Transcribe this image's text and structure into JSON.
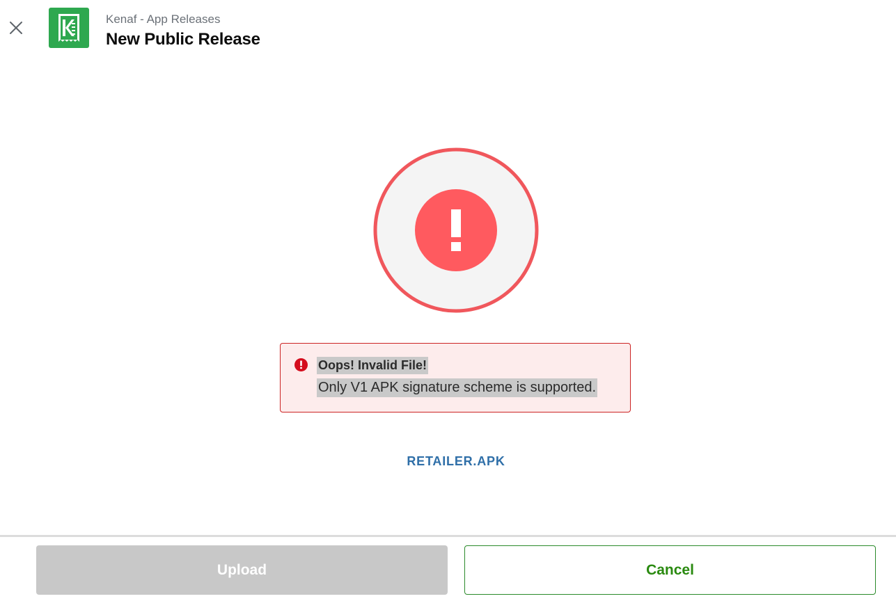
{
  "header": {
    "subtitle": "Kenaf - App Releases",
    "title": "New Public Release",
    "logo_color": "#2ea84f"
  },
  "status": {
    "state": "error",
    "ring_color": "#f0575c",
    "inner_color": "#ff5a5f"
  },
  "alert": {
    "title": "Oops! Invalid File!",
    "message": "Only V1 APK signature scheme is supported."
  },
  "file": {
    "name": "RETAILER.APK"
  },
  "footer": {
    "upload_label": "Upload",
    "cancel_label": "Cancel"
  },
  "icons": {
    "close": "close-icon",
    "logo": "app-logo",
    "status": "error-exclamation-icon",
    "alert": "alert-error-icon"
  }
}
